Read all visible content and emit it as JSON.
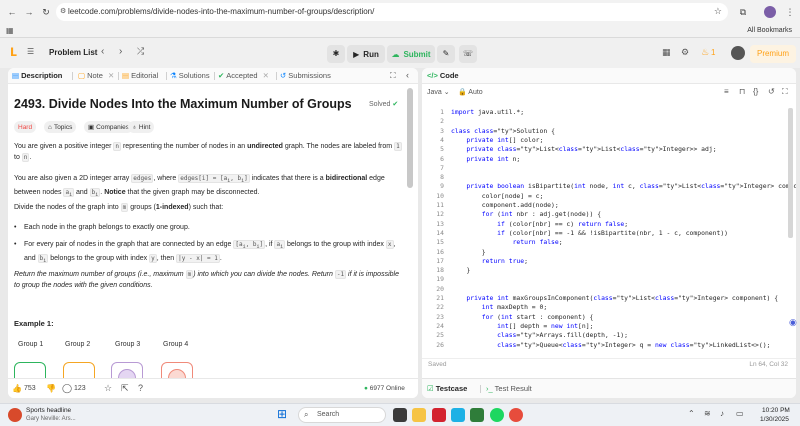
{
  "browser": {
    "url": "leetcode.com/problems/divide-nodes-into-the-maximum-number-of-groups/description/",
    "bookmarks_label": "All Bookmarks"
  },
  "topbar": {
    "problem_list": "Problem List",
    "run": "Run",
    "submit": "Submit",
    "streak": "1",
    "premium": "Premium"
  },
  "left_tabs": [
    {
      "label": "Description"
    },
    {
      "label": "Note"
    },
    {
      "label": "Editorial"
    },
    {
      "label": "Solutions"
    },
    {
      "label": "Accepted"
    },
    {
      "label": "Submissions"
    }
  ],
  "problem": {
    "title": "2493. Divide Nodes Into the Maximum Number of Groups",
    "solved": "Solved",
    "difficulty": "Hard",
    "topics": "Topics",
    "companies": "Companies",
    "hint": "Hint",
    "p1_a": "You are given a positive integer ",
    "p1_n": "n",
    "p1_b": " representing the number of nodes in an ",
    "p1_bold": "undirected",
    "p1_c": " graph. The nodes are labeled from ",
    "p1_one": "1",
    "p1_to": " to ",
    "p1_n2": "n",
    "p1_end": ".",
    "p2_a": "You are also given a 2D integer array ",
    "p2_edges": "edges",
    "p2_b": ", where ",
    "p2_edgei": "edges[i] = [a",
    "p2_c": " indicates that there is a ",
    "p2_bold": "bidirectional",
    "p2_d": " edge between nodes ",
    "p2_ai": "a",
    "p2_and": " and ",
    "p2_bi": "b",
    "p2_e": ". ",
    "p2_notice": "Notice",
    "p2_f": " that the given graph may be disconnected.",
    "p3_a": "Divide the nodes of the graph into ",
    "p3_m": "m",
    "p3_b": " groups (",
    "p3_bold": "1-indexed",
    "p3_c": ") such that:",
    "b1": "Each node in the graph belongs to exactly one group.",
    "b2_a": "For every pair of nodes in the graph that are connected by an edge ",
    "b2_code1": "[a",
    "b2_b": ", if ",
    "b2_ai": "a",
    "b2_c": " belongs to the group with index ",
    "b2_x": "x",
    "b2_d": ", and ",
    "b2_bi": "b",
    "b2_e": " belongs to the group with index ",
    "b2_y": "y",
    "b2_f": ", then ",
    "b2_abs": "|y - x| = 1",
    "b2_g": ".",
    "p4_a": "Return the maximum number of groups (i.e., maximum ",
    "p4_m": "m",
    "p4_b": ") into which you can divide the nodes. Return ",
    "p4_neg": "-1",
    "p4_c": " if it is impossible to group the nodes with the given conditions.",
    "example_title": "Example 1:",
    "groups": [
      "Group 1",
      "Group 2",
      "Group 3",
      "Group 4"
    ]
  },
  "left_footer": {
    "likes": "753",
    "comments": "123",
    "online": "6977 Online"
  },
  "editor": {
    "tab_label": "Code",
    "language": "Java",
    "mode": "Auto",
    "saved": "Saved",
    "cursor": "Ln 64, Col 32",
    "testcase": "Testcase",
    "test_result": "Test Result",
    "lines": [
      {
        "n": "1",
        "t": "import java.util.*;"
      },
      {
        "n": "2",
        "t": ""
      },
      {
        "n": "3",
        "t": "class Solution {"
      },
      {
        "n": "4",
        "t": "    private int[] color;"
      },
      {
        "n": "5",
        "t": "    private List<List<Integer>> adj;"
      },
      {
        "n": "6",
        "t": "    private int n;"
      },
      {
        "n": "7",
        "t": ""
      },
      {
        "n": "8",
        "t": ""
      },
      {
        "n": "9",
        "t": "    private boolean isBipartite(int node, int c, List<Integer> component) {"
      },
      {
        "n": "10",
        "t": "        color[node] = c;"
      },
      {
        "n": "11",
        "t": "        component.add(node);"
      },
      {
        "n": "12",
        "t": "        for (int nbr : adj.get(node)) {"
      },
      {
        "n": "13",
        "t": "            if (color[nbr] == c) return false;"
      },
      {
        "n": "14",
        "t": "            if (color[nbr] == -1 && !isBipartite(nbr, 1 - c, component))"
      },
      {
        "n": "15",
        "t": "                return false;"
      },
      {
        "n": "16",
        "t": "        }"
      },
      {
        "n": "17",
        "t": "        return true;"
      },
      {
        "n": "18",
        "t": "    }"
      },
      {
        "n": "19",
        "t": ""
      },
      {
        "n": "20",
        "t": ""
      },
      {
        "n": "21",
        "t": "    private int maxGroupsInComponent(List<Integer> component) {"
      },
      {
        "n": "22",
        "t": "        int maxDepth = 0;"
      },
      {
        "n": "23",
        "t": "        for (int start : component) {"
      },
      {
        "n": "24",
        "t": "            int[] depth = new int[n];"
      },
      {
        "n": "25",
        "t": "            Arrays.fill(depth, -1);"
      },
      {
        "n": "26",
        "t": "            Queue<Integer> q = new LinkedList<>();"
      }
    ]
  },
  "taskbar": {
    "news_title": "Sports headline",
    "news_sub": "Gary Neville: Ars...",
    "search": "Search",
    "time": "10:20 PM",
    "date": "1/30/2025"
  },
  "colors": {
    "accent_orange": "#ffa116",
    "hard_red": "#ef4743",
    "solved_green": "#2db55d",
    "keyword_blue": "#0000ff"
  }
}
